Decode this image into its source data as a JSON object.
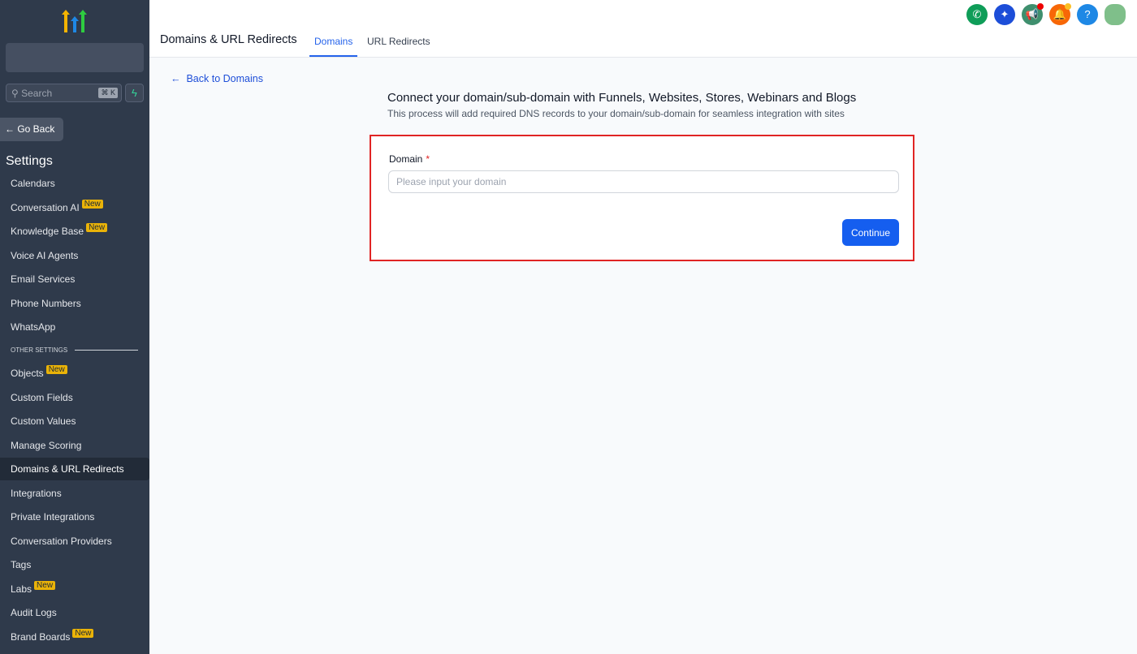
{
  "sidebar": {
    "search_placeholder": "Search",
    "search_shortcut": "⌘ K",
    "go_back": "← Go Back",
    "heading": "Settings",
    "other_settings": "OTHER SETTINGS",
    "items": [
      {
        "label": "Calendars"
      },
      {
        "label": "Conversation AI",
        "badge": "New"
      },
      {
        "label": "Knowledge Base",
        "badge": "New"
      },
      {
        "label": "Voice AI Agents"
      },
      {
        "label": "Email Services"
      },
      {
        "label": "Phone Numbers"
      },
      {
        "label": "WhatsApp"
      }
    ],
    "other_items": [
      {
        "label": "Objects",
        "badge": "New"
      },
      {
        "label": "Custom Fields"
      },
      {
        "label": "Custom Values"
      },
      {
        "label": "Manage Scoring"
      },
      {
        "label": "Domains & URL Redirects",
        "active": true
      },
      {
        "label": "Integrations"
      },
      {
        "label": "Private Integrations"
      },
      {
        "label": "Conversation Providers"
      },
      {
        "label": "Tags"
      },
      {
        "label": "Labs",
        "badge": "New"
      },
      {
        "label": "Audit Logs"
      },
      {
        "label": "Brand Boards",
        "badge": "New"
      }
    ]
  },
  "header": {
    "title": "Domains & URL Redirects",
    "tabs": [
      {
        "label": "Domains"
      },
      {
        "label": "URL Redirects"
      }
    ],
    "help": "?"
  },
  "main": {
    "back_link": "Back to Domains",
    "heading": "Connect your domain/sub-domain with Funnels, Websites, Stores, Webinars and Blogs",
    "subheading": "This process will add required DNS records to your domain/sub-domain for seamless integration with sites",
    "domain_label": "Domain",
    "required_mark": "*",
    "domain_value": "",
    "domain_placeholder": "Please input your domain",
    "continue": "Continue"
  }
}
